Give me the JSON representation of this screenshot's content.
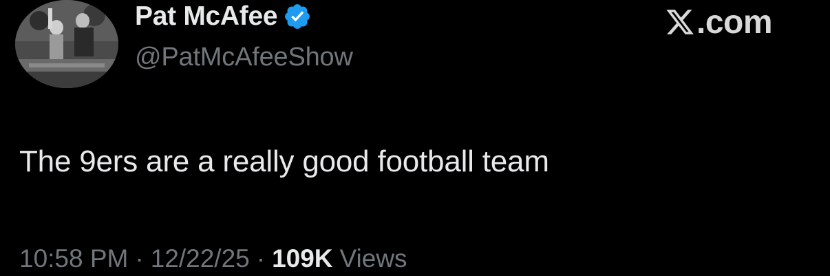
{
  "profile": {
    "display_name": "Pat McAfee",
    "handle": "@PatMcAfeeShow",
    "verified": true,
    "verified_color": "#1d9bf0",
    "avatar_icon": "profile-photo"
  },
  "brand": {
    "label": ".com",
    "icon": "x-logo-icon"
  },
  "tweet": {
    "text": "The 9ers are a really good football team"
  },
  "meta": {
    "time": "10:58 PM",
    "separator": "·",
    "date": "12/22/25",
    "views_count": "109K",
    "views_label": "Views"
  },
  "colors": {
    "background": "#000000",
    "primary_text": "#e7e9ea",
    "secondary_text": "#71767b"
  }
}
